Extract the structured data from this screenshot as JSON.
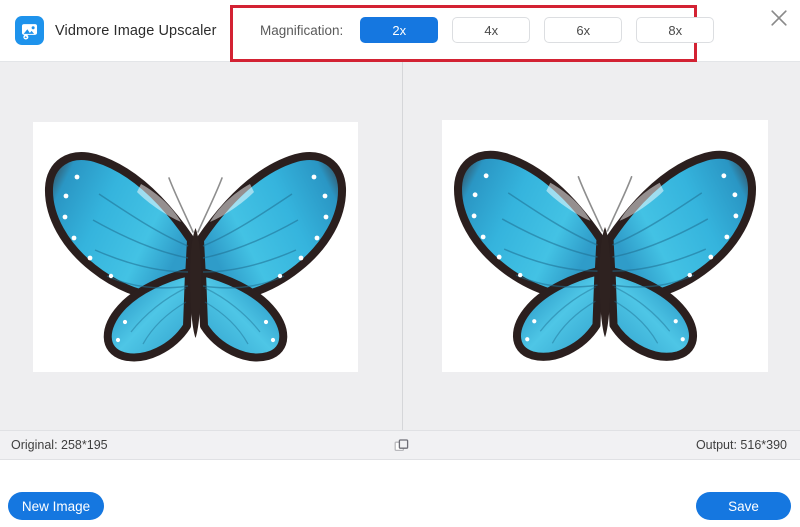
{
  "app": {
    "title": "Vidmore Image Upscaler",
    "logo_icon": "image-photo-icon"
  },
  "header": {
    "magnification_label": "Magnification:",
    "magnification_options": [
      {
        "label": "2x",
        "selected": true
      },
      {
        "label": "4x",
        "selected": false
      },
      {
        "label": "6x",
        "selected": false
      },
      {
        "label": "8x",
        "selected": false
      }
    ],
    "close_icon": "close-icon",
    "annotation_color": "#d32233"
  },
  "preview": {
    "left_image_alt": "blue morpho butterfly original",
    "right_image_alt": "blue morpho butterfly upscaled",
    "compare_icon": "compare-squares-icon"
  },
  "status": {
    "original": "Original: 258*195",
    "output": "Output: 516*390"
  },
  "footer": {
    "new_image_label": "New Image",
    "save_label": "Save",
    "accent_color": "#1577e0"
  }
}
